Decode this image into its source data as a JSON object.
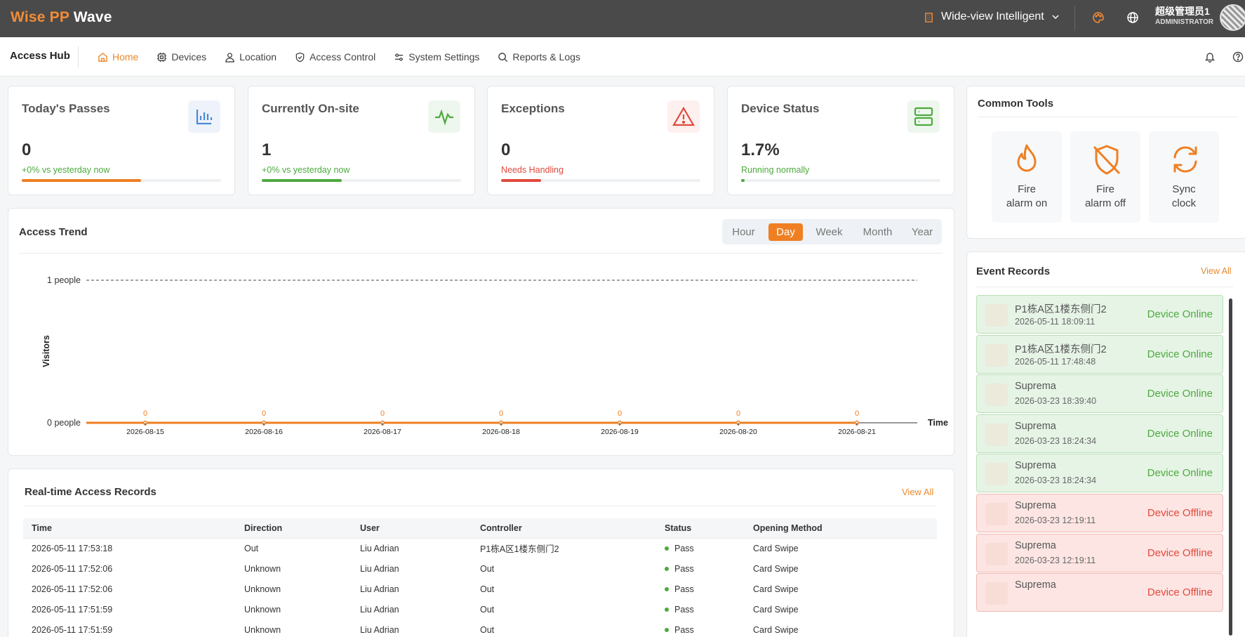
{
  "header": {
    "brand_accent": "Wise PP",
    "brand_rest": "Wave",
    "org": "Wide-view Intelligent",
    "user_name": "超级管理员1",
    "user_role": "ADMINISTRATOR"
  },
  "nav": {
    "app_title": "Access Hub",
    "items": [
      {
        "label": "Home",
        "icon": "home-icon",
        "active": true
      },
      {
        "label": "Devices",
        "icon": "chip-icon"
      },
      {
        "label": "Location",
        "icon": "person-icon"
      },
      {
        "label": "Access Control",
        "icon": "shield-icon"
      },
      {
        "label": "System Settings",
        "icon": "sliders-icon"
      },
      {
        "label": "Reports & Logs",
        "icon": "search-icon"
      }
    ]
  },
  "stats": [
    {
      "title": "Today's Passes",
      "value": "0",
      "sub": "+0% vs yesterday now",
      "sub_color": "#4daa3e",
      "bar_color": "#ef7f22",
      "progress": 0.6,
      "icon": "bar-chart-icon"
    },
    {
      "title": "Currently On-site",
      "value": "1",
      "sub": "+0% vs yesterday now",
      "sub_color": "#4daa3e",
      "bar_color": "#4daa3e",
      "progress": 0.4,
      "icon": "pulse-icon"
    },
    {
      "title": "Exceptions",
      "value": "0",
      "sub": "Needs Handling",
      "sub_color": "#e0493d",
      "bar_color": "#e0493d",
      "progress": 0.2,
      "icon": "warning-icon"
    },
    {
      "title": "Device Status",
      "value": "1.7%",
      "sub": "Running normally",
      "sub_color": "#4daa3e",
      "bar_color": "#4daa3e",
      "progress": 0.017,
      "icon": "server-icon"
    }
  ],
  "trend": {
    "title": "Access Trend",
    "ranges": [
      "Hour",
      "Day",
      "Week",
      "Month",
      "Year"
    ],
    "active_range": "Day"
  },
  "chart_data": {
    "type": "line",
    "title": "",
    "xlabel": "Time",
    "ylabel": "Visitors",
    "x": [
      "2026-08-15",
      "2026-08-16",
      "2026-08-17",
      "2026-08-18",
      "2026-08-19",
      "2026-08-20",
      "2026-08-21"
    ],
    "series": [
      {
        "values": [
          0,
          0,
          0,
          0,
          0,
          0,
          0
        ],
        "color": "#ef7f22"
      }
    ],
    "y_ticks": [
      "0 people",
      "1 people"
    ],
    "ylim": [
      0,
      1
    ],
    "grid": false
  },
  "records": {
    "title": "Real-time Access Records",
    "view_all": "View All",
    "columns": [
      "Time",
      "Direction",
      "User",
      "Controller",
      "Status",
      "Opening Method"
    ],
    "rows": [
      [
        "2026-05-11 17:53:18",
        "Out",
        "Liu Adrian",
        "P1栋A区1楼东侧门2",
        "Pass",
        "Card Swipe"
      ],
      [
        "2026-05-11 17:52:06",
        "Unknown",
        "Liu Adrian",
        "Out",
        "Pass",
        "Card Swipe"
      ],
      [
        "2026-05-11 17:52:06",
        "Unknown",
        "Liu Adrian",
        "Out",
        "Pass",
        "Card Swipe"
      ],
      [
        "2026-05-11 17:51:59",
        "Unknown",
        "Liu Adrian",
        "Out",
        "Pass",
        "Card Swipe"
      ],
      [
        "2026-05-11 17:51:59",
        "Unknown",
        "Liu Adrian",
        "Out",
        "Pass",
        "Card Swipe"
      ]
    ]
  },
  "tools": {
    "title": "Common Tools",
    "items": [
      {
        "label1": "Fire",
        "label2": "alarm on",
        "icon": "flame-icon"
      },
      {
        "label1": "Fire",
        "label2": "alarm off",
        "icon": "shield-off-icon"
      },
      {
        "label1": "Sync",
        "label2": "clock",
        "icon": "refresh-icon"
      }
    ]
  },
  "events": {
    "title": "Event Records",
    "view_all": "View All",
    "items": [
      {
        "name": "P1栋A区1楼东侧门2",
        "time": "2026-05-11 18:09:11",
        "status": "Device Online",
        "type": "on"
      },
      {
        "name": "P1栋A区1楼东侧门2",
        "time": "2026-05-11 17:48:48",
        "status": "Device Online",
        "type": "on"
      },
      {
        "name": "Suprema",
        "time": "2026-03-23 18:39:40",
        "status": "Device Online",
        "type": "on"
      },
      {
        "name": "Suprema",
        "time": "2026-03-23 18:24:34",
        "status": "Device Online",
        "type": "on"
      },
      {
        "name": "Suprema",
        "time": "2026-03-23 18:24:34",
        "status": "Device Online",
        "type": "on"
      },
      {
        "name": "Suprema",
        "time": "2026-03-23 12:19:11",
        "status": "Device Offline",
        "type": "off"
      },
      {
        "name": "Suprema",
        "time": "2026-03-23 12:19:11",
        "status": "Device Offline",
        "type": "off"
      },
      {
        "name": "Suprema",
        "time": "",
        "status": "Device Offline",
        "type": "off"
      }
    ]
  }
}
